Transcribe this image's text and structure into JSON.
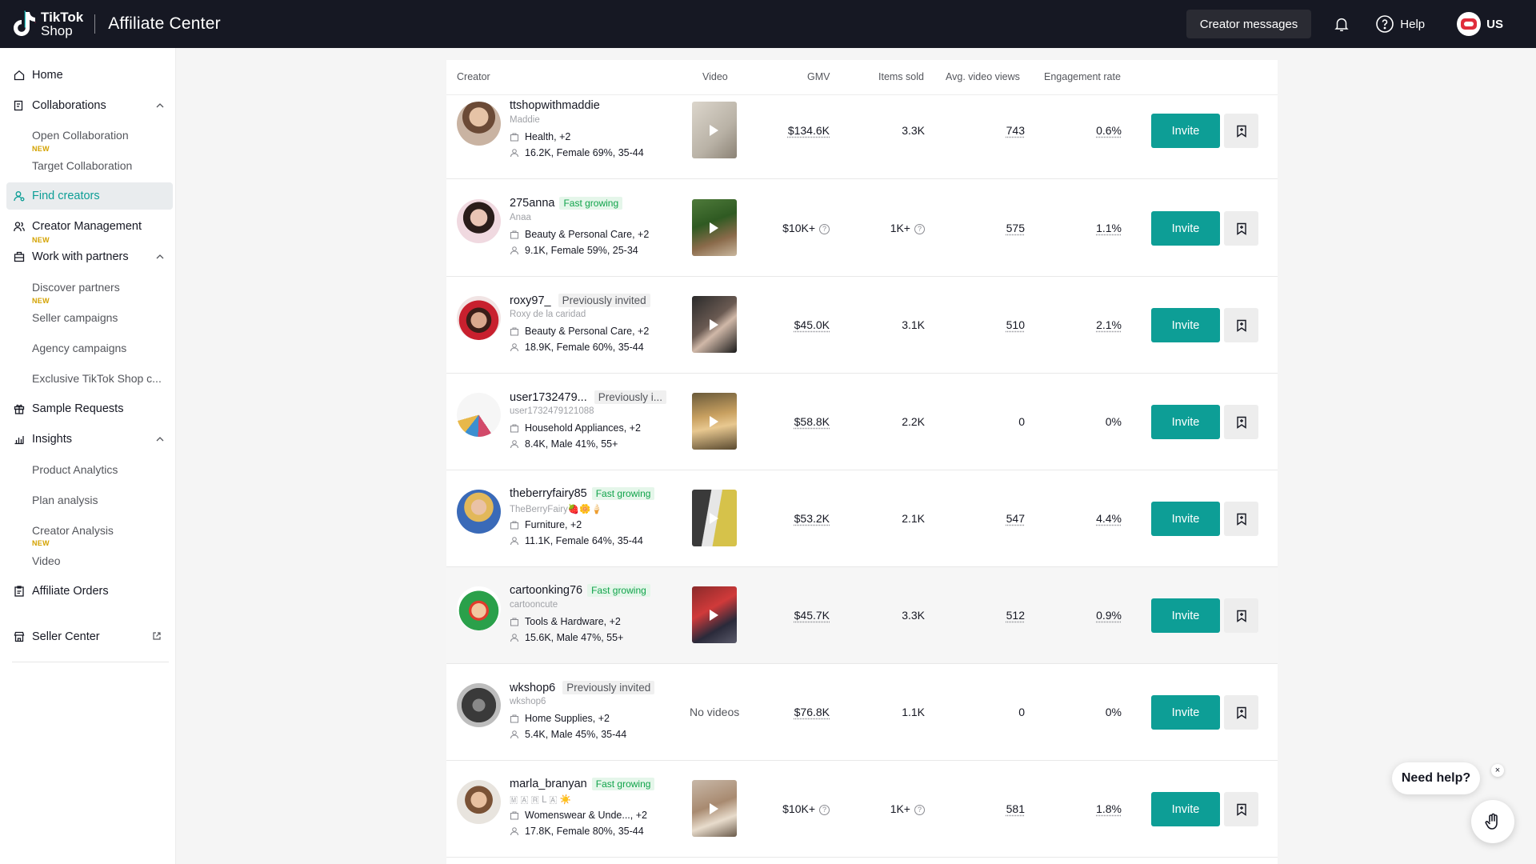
{
  "header": {
    "logo_line1": "TikTok",
    "logo_line2": "Shop",
    "app_title": "Affiliate Center",
    "creator_messages": "Creator messages",
    "help": "Help",
    "region": "US"
  },
  "sidebar": {
    "home": "Home",
    "collaborations": "Collaborations",
    "open_collaboration": "Open Collaboration",
    "target_collaboration": "Target Collaboration",
    "find_creators": "Find creators",
    "creator_management": "Creator Management",
    "work_with_partners": "Work with partners",
    "discover_partners": "Discover partners",
    "seller_campaigns": "Seller campaigns",
    "agency_campaigns": "Agency campaigns",
    "exclusive_shop": "Exclusive TikTok Shop c...",
    "sample_requests": "Sample Requests",
    "insights": "Insights",
    "product_analytics": "Product Analytics",
    "plan_analysis": "Plan analysis",
    "creator_analysis": "Creator Analysis",
    "video": "Video",
    "affiliate_orders": "Affiliate Orders",
    "seller_center": "Seller Center",
    "new_tag": "NEW"
  },
  "table": {
    "headers": {
      "creator": "Creator",
      "video": "Video",
      "gmv": "GMV",
      "items_sold": "Items sold",
      "avg_views": "Avg. video views",
      "engagement": "Engagement rate"
    },
    "invite_label": "Invite",
    "no_videos": "No videos",
    "rows": [
      {
        "handle": "ttshopwithmaddie",
        "badge": "",
        "nickname": "Maddie",
        "category": "Health, +2",
        "audience": "16.2K, Female 69%, 35-44",
        "gmv": "$134.6K",
        "items": "3.3K",
        "views": "743",
        "engagement": "0.6%"
      },
      {
        "handle": "275anna",
        "badge": "Fast growing",
        "nickname": "Anaa",
        "category": "Beauty & Personal Care, +2",
        "audience": "9.1K, Female 59%, 25-34",
        "gmv": "$10K+",
        "items": "1K+",
        "views": "575",
        "engagement": "1.1%"
      },
      {
        "handle": "roxy97_",
        "badge": "Previously invited",
        "nickname": "Roxy de la caridad",
        "category": "Beauty & Personal Care, +2",
        "audience": "18.9K, Female 60%, 35-44",
        "gmv": "$45.0K",
        "items": "3.1K",
        "views": "510",
        "engagement": "2.1%"
      },
      {
        "handle": "user1732479...",
        "badge": "Previously i...",
        "nickname": "user1732479121088",
        "category": "Household Appliances, +2",
        "audience": "8.4K, Male 41%, 55+",
        "gmv": "$58.8K",
        "items": "2.2K",
        "views": "0",
        "engagement": "0%"
      },
      {
        "handle": "theberryfairy85",
        "badge": "Fast growing",
        "nickname": "TheBerryFairy🍓🌼🍦",
        "category": "Furniture, +2",
        "audience": "11.1K, Female 64%, 35-44",
        "gmv": "$53.2K",
        "items": "2.1K",
        "views": "547",
        "engagement": "4.4%"
      },
      {
        "handle": "cartoonking76",
        "badge": "Fast growing",
        "nickname": "cartooncute",
        "category": "Tools & Hardware, +2",
        "audience": "15.6K, Male 47%, 55+",
        "gmv": "$45.7K",
        "items": "3.3K",
        "views": "512",
        "engagement": "0.9%"
      },
      {
        "handle": "wkshop6",
        "badge": "Previously invited",
        "nickname": "wkshop6",
        "category": "Home Supplies, +2",
        "audience": "5.4K, Male 45%, 35-44",
        "gmv": "$76.8K",
        "items": "1.1K",
        "views": "0",
        "engagement": "0%"
      },
      {
        "handle": "marla_branyan",
        "badge": "Fast growing",
        "nickname": "🇲 🇦 🇷 L 🇦 ☀️",
        "category": "Womenswear & Unde..., +2",
        "audience": "17.8K, Female 80%, 35-44",
        "gmv": "$10K+",
        "items": "1K+",
        "views": "581",
        "engagement": "1.8%"
      }
    ]
  },
  "help_widget": {
    "label": "Need help?",
    "close": "×"
  },
  "colors": {
    "accent": "#0d9e96",
    "topbar": "#161823",
    "fast_growing": "#10a34a",
    "new_tag": "#d4a200"
  }
}
